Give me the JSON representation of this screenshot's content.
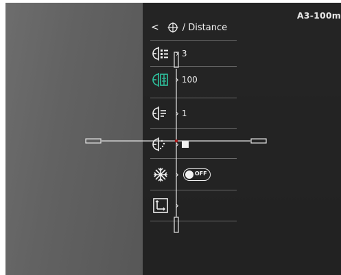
{
  "header": {
    "profile_label": "A3-100m",
    "back_glyph": "<",
    "title": "/ Distance",
    "icon": "crosshair-icon"
  },
  "menu": [
    {
      "icon": "reticle-list-icon",
      "value": "3"
    },
    {
      "icon": "reticle-distance-icon",
      "value": "100",
      "highlight_color": "#2ec4a0"
    },
    {
      "icon": "reticle-adjust-icon",
      "value": "1"
    },
    {
      "icon": "reticle-dots-icon",
      "value": "■"
    },
    {
      "icon": "snowflake-icon",
      "value": "OFF"
    },
    {
      "icon": "zeroing-axis-icon",
      "value": ""
    }
  ],
  "reticle": {
    "center_dot_color": "#b01818",
    "line_color": "#e6e6e6"
  },
  "colors": {
    "panel_text": "#eeeeee",
    "accent": "#2ec4a0"
  }
}
